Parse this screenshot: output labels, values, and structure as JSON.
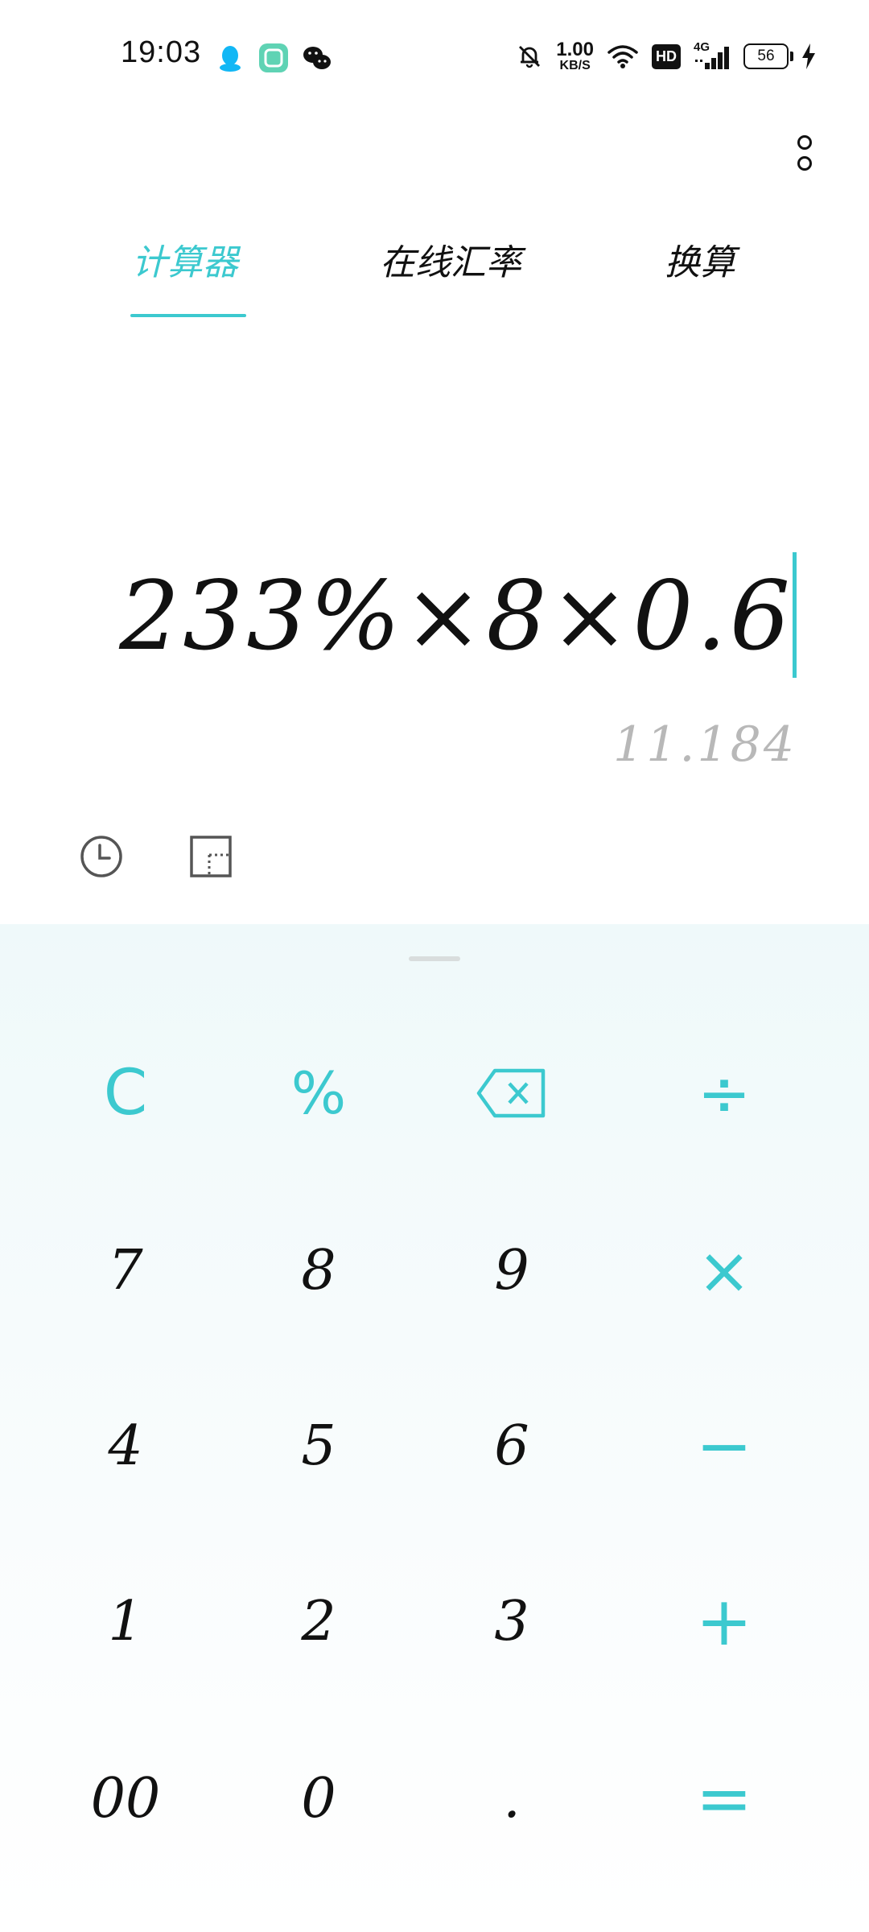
{
  "status_bar": {
    "time": "19:03",
    "net_speed_value": "1.00",
    "net_speed_unit": "KB/S",
    "hd_label": "HD",
    "signal_label": "4G",
    "battery_level": "56"
  },
  "tabs": [
    {
      "label": "计算器",
      "active": true
    },
    {
      "label": "在线汇率",
      "active": false
    },
    {
      "label": "换算",
      "active": false
    }
  ],
  "display": {
    "expression": "233%×8×0.6",
    "result": "11.184"
  },
  "keys": {
    "clear": "C",
    "percent": "%",
    "divide": "÷",
    "multiply": "×",
    "minus": "−",
    "plus": "+",
    "equals": "=",
    "seven": "7",
    "eight": "8",
    "nine": "9",
    "four": "4",
    "five": "5",
    "six": "6",
    "one": "1",
    "two": "2",
    "three": "3",
    "double_zero": "00",
    "zero": "0",
    "dot": "."
  },
  "colors": {
    "accent": "#3cc9cf",
    "text": "#111111",
    "result_text": "#b8b8b8",
    "keypad_bg": "#eff9fa"
  }
}
